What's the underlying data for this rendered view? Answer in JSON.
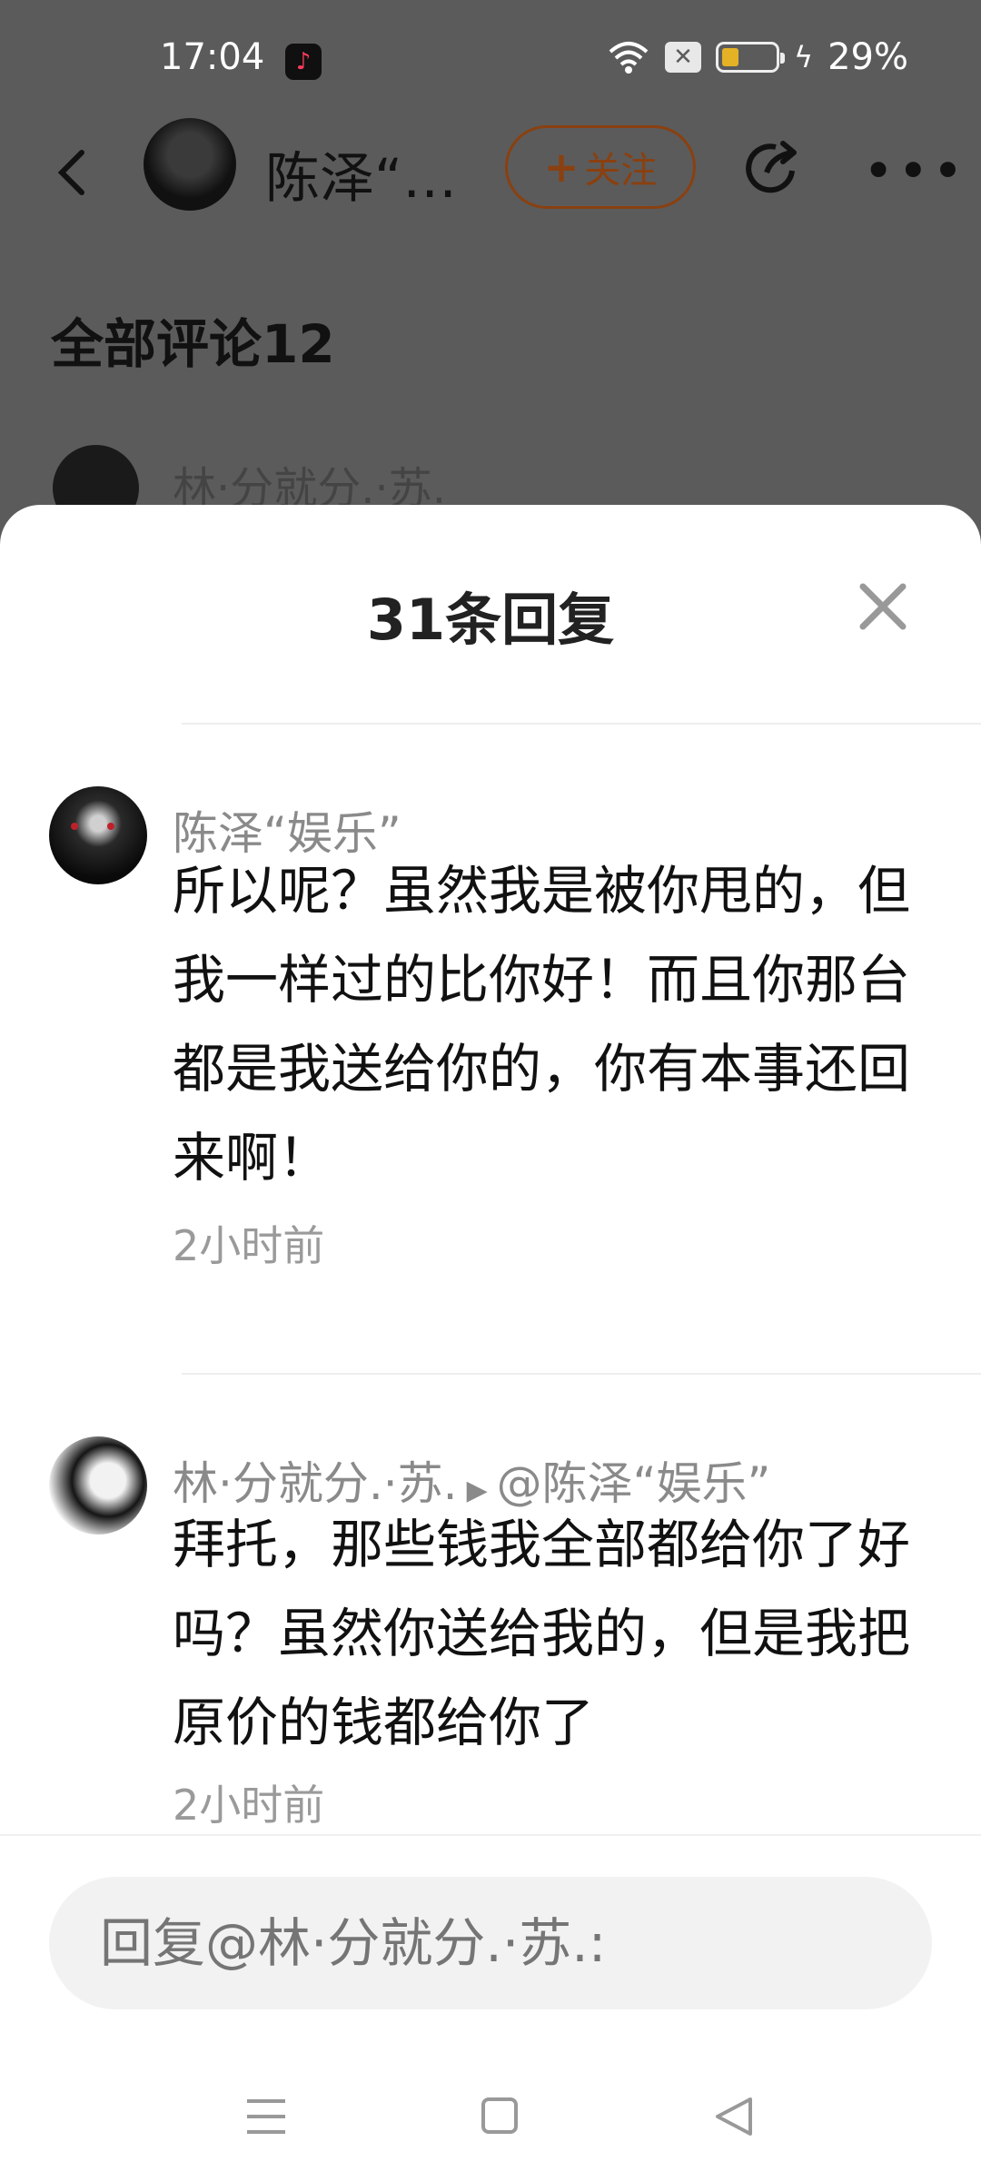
{
  "status_bar": {
    "time": "17:04",
    "battery_percent": "29%",
    "battery_level": 0.29,
    "icons": [
      "tiktok-icon",
      "wifi-icon",
      "sim-x-icon",
      "battery-icon",
      "charging-bolt-icon"
    ]
  },
  "header": {
    "name": "陈泽“…",
    "follow_label": "关注",
    "icons": [
      "back-icon",
      "share-icon",
      "more-icon"
    ]
  },
  "background": {
    "comments_title": "全部评论12",
    "first_comment_name": "林·分就分.·苏."
  },
  "sheet": {
    "title": "31条回复",
    "close_icon": "close-icon",
    "replies": [
      {
        "username": "陈泽“娱乐”",
        "content": "所以呢？虽然我是被你甩的，但我一样过的比你好！而且你那台都是我送给你的，你有本事还回来啊！",
        "time": "2小时前"
      },
      {
        "username": "林·分就分.·苏.",
        "reply_to": "@陈泽“娱乐”",
        "content": "拜托，那些钱我全部都给你了好吗？虽然你送给我的，但是我把原价的钱都给你了",
        "time": "2小时前"
      }
    ]
  },
  "reply_input": {
    "placeholder": "回复@林·分就分.·苏.:"
  },
  "nav_bar": {
    "icons": [
      "menu-icon",
      "home-icon",
      "back-triangle-icon"
    ]
  }
}
